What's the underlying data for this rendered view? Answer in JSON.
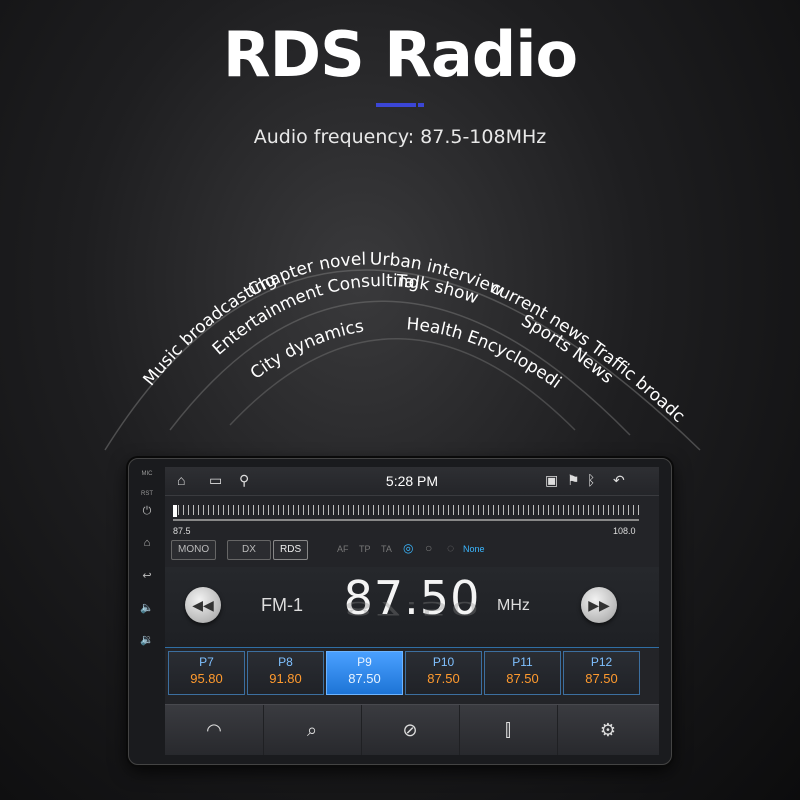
{
  "headline": "RDS Radio",
  "subtitle": "Audio frequency: 87.5-108MHz",
  "colors": {
    "accent": "#3b46d6",
    "preset_active": "#2a8cff",
    "preset_freq": "#ff9a2e",
    "preset_label": "#7fc0ff",
    "rds_highlight": "#3bb7ff"
  },
  "program_arcs": [
    {
      "label": "Music broadcasting"
    },
    {
      "label": "Chapter novel"
    },
    {
      "label": "Urban interview"
    },
    {
      "label": "current news"
    },
    {
      "label": "Traffic broadcast"
    },
    {
      "label": "Entertainment Consulting"
    },
    {
      "label": "Talk show"
    },
    {
      "label": "Sports News"
    },
    {
      "label": "City dynamics"
    },
    {
      "label": "Health Encyclopedia"
    }
  ],
  "device": {
    "side_buttons": [
      {
        "label": "MIC",
        "icon": "mic-label"
      },
      {
        "label": "RST",
        "icon": "reset-label"
      },
      {
        "icon": "power-icon"
      },
      {
        "icon": "home-icon"
      },
      {
        "icon": "back-icon"
      },
      {
        "icon": "volume-up-icon"
      },
      {
        "icon": "volume-down-icon"
      }
    ],
    "status": {
      "time": "5:28 PM",
      "left_icons": [
        "home-icon",
        "recent-apps-icon",
        "usb-icon"
      ],
      "right_icons": [
        "cast-icon",
        "location-icon",
        "bluetooth-icon",
        "back-icon"
      ]
    },
    "tuner": {
      "min": "87.5",
      "max": "108.0",
      "position": 0
    },
    "toggles": [
      "MONO",
      "DX",
      "RDS"
    ],
    "rds_flags": [
      "AF",
      "TP",
      "TA"
    ],
    "rds_program": "None",
    "band": "FM-1",
    "frequency": "87.50",
    "unit": "MHz",
    "presets": [
      {
        "name": "P7",
        "freq": "95.80",
        "active": false
      },
      {
        "name": "P8",
        "freq": "91.80",
        "active": false
      },
      {
        "name": "P9",
        "freq": "87.50",
        "active": true
      },
      {
        "name": "P10",
        "freq": "87.50",
        "active": false
      },
      {
        "name": "P11",
        "freq": "87.50",
        "active": false
      },
      {
        "name": "P12",
        "freq": "87.50",
        "active": false
      }
    ],
    "bottom_buttons": [
      "rds-signal-icon",
      "search-icon",
      "scan-icon",
      "equalizer-icon",
      "settings-icon"
    ]
  }
}
